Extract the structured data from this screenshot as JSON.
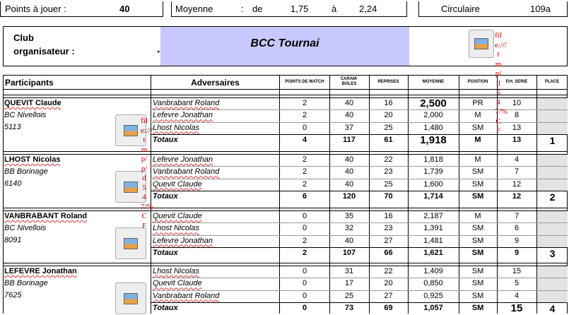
{
  "top": {
    "points_label": "Points à jouer :",
    "points_value": "40",
    "moyenne_label": "Moyenne",
    "moyenne_colon": ":",
    "moyenne_de": "de",
    "moyenne_min": "1,75",
    "moyenne_a": "à",
    "moyenne_max": "2,24",
    "circulaire_label": "Circulaire",
    "circulaire_value": "109a"
  },
  "club": {
    "label_line1": "Club",
    "label_line2": "organisateur :",
    "name": "BCC Tournai"
  },
  "headers": {
    "participants": "Participants",
    "adversaires": "Adversaires",
    "points_match": "POINTS DE MATCH",
    "carambolages": "CARAM-\nBOLES",
    "reprises": "REPRISES",
    "moyenne": "MOYENNE",
    "position": "POSITION",
    "ph_serie": "P.H. SERIE",
    "place": "PLACE"
  },
  "broken_link_text": "file:///tmp/d547/%CF",
  "broken_link_text_2": "file:///tmp/p/d547/%CF",
  "totaux_label": "Totaux",
  "players": [
    {
      "name": "QUEVIT Claude",
      "club": "BC Nivellois",
      "id": "5113",
      "rows": [
        {
          "adv": "Vanbrabant Roland",
          "pts": "2",
          "car": "40",
          "rep": "16",
          "moy": "2,500",
          "pos": "PR",
          "ser": "10"
        },
        {
          "adv": "Lefevre Jonathan",
          "pts": "2",
          "car": "40",
          "rep": "20",
          "moy": "2,000",
          "pos": "M",
          "ser": "8"
        },
        {
          "adv": "Lhost Nicolas",
          "pts": "0",
          "car": "37",
          "rep": "25",
          "moy": "1,480",
          "pos": "SM",
          "ser": "13"
        }
      ],
      "total": {
        "pts": "4",
        "car": "117",
        "rep": "61",
        "moy": "1,918",
        "pos": "M",
        "ser": "13",
        "place": "1"
      }
    },
    {
      "name": "LHOST Nicolas",
      "club": "BB Borinage",
      "id": "6140",
      "rows": [
        {
          "adv": "Lefevre Jonathan",
          "pts": "2",
          "car": "40",
          "rep": "22",
          "moy": "1,818",
          "pos": "M",
          "ser": "4"
        },
        {
          "adv": "Vanbrabant Roland",
          "pts": "2",
          "car": "40",
          "rep": "23",
          "moy": "1,739",
          "pos": "SM",
          "ser": "7"
        },
        {
          "adv": "Quevit Claude",
          "pts": "2",
          "car": "40",
          "rep": "25",
          "moy": "1,600",
          "pos": "SM",
          "ser": "12"
        }
      ],
      "total": {
        "pts": "6",
        "car": "120",
        "rep": "70",
        "moy": "1,714",
        "pos": "SM",
        "ser": "12",
        "place": "2"
      }
    },
    {
      "name": "VANBRABANT Roland",
      "club": "BC Nivellois",
      "id": "8091",
      "rows": [
        {
          "adv": "Quevit Claude",
          "pts": "0",
          "car": "35",
          "rep": "16",
          "moy": "2,187",
          "pos": "M",
          "ser": "7"
        },
        {
          "adv": "Lhost Nicolas",
          "pts": "0",
          "car": "32",
          "rep": "23",
          "moy": "1,391",
          "pos": "SM",
          "ser": "6"
        },
        {
          "adv": "Lefevre Jonathan",
          "pts": "2",
          "car": "40",
          "rep": "27",
          "moy": "1,481",
          "pos": "SM",
          "ser": "9"
        }
      ],
      "total": {
        "pts": "2",
        "car": "107",
        "rep": "66",
        "moy": "1,621",
        "pos": "SM",
        "ser": "9",
        "place": "3"
      }
    },
    {
      "name": "LEFEVRE Jonathan",
      "club": "BB Borinage",
      "id": "7625",
      "rows": [
        {
          "adv": "Lhost Nicolas",
          "pts": "0",
          "car": "31",
          "rep": "22",
          "moy": "1,409",
          "pos": "SM",
          "ser": "15"
        },
        {
          "adv": "Quevit Claude",
          "pts": "0",
          "car": "17",
          "rep": "20",
          "moy": "0,850",
          "pos": "SM",
          "ser": "5"
        },
        {
          "adv": "Vanbrabant Roland",
          "pts": "0",
          "car": "25",
          "rep": "27",
          "moy": "0,925",
          "pos": "SM",
          "ser": "4"
        }
      ],
      "total": {
        "pts": "0",
        "car": "73",
        "rep": "69",
        "moy": "1,057",
        "pos": "SM",
        "ser": "15",
        "place": "4"
      }
    }
  ],
  "colors": {
    "club_band": "#c8c8ff",
    "place_cell": "#e3e3e3",
    "broken_link": "#cc0000"
  }
}
